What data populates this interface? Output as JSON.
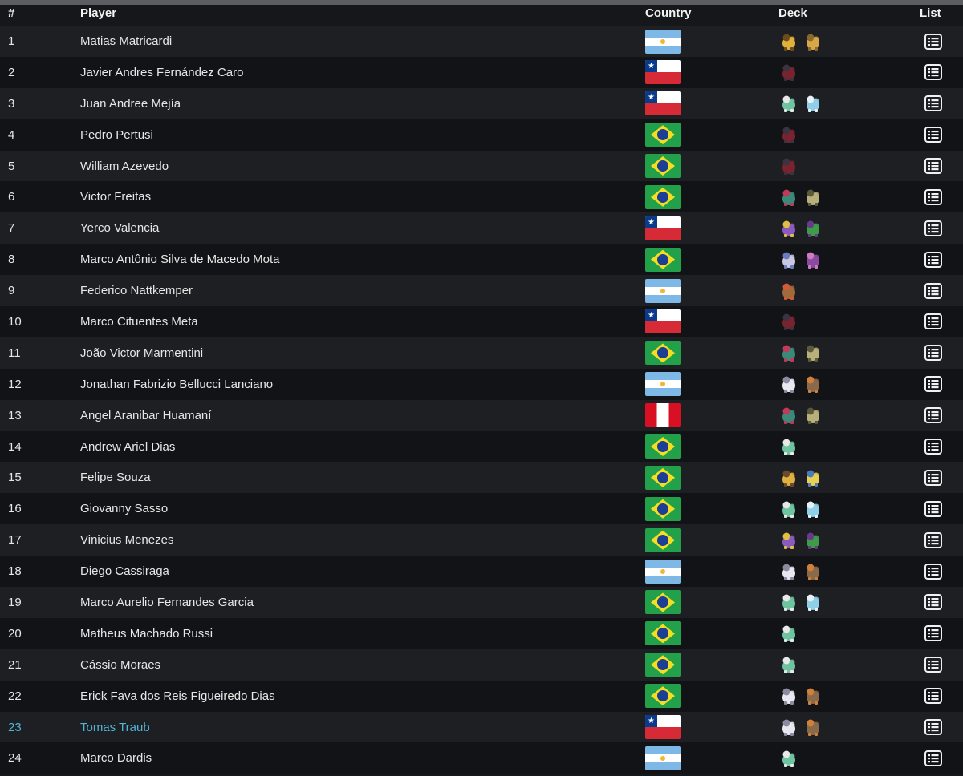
{
  "header": {
    "rank": "#",
    "player": "Player",
    "country": "Country",
    "deck": "Deck",
    "list": "List"
  },
  "rows": [
    {
      "rank": "1",
      "player": "Matias Matricardi",
      "country": "flag-ar",
      "deck": [
        "pokemon-a",
        "pokemon-b"
      ]
    },
    {
      "rank": "2",
      "player": "Javier Andres Fernández Caro",
      "country": "flag-cl",
      "deck": [
        "pokemon-c"
      ]
    },
    {
      "rank": "3",
      "player": "Juan Andree Mejía",
      "country": "flag-cl",
      "deck": [
        "pokemon-d",
        "pokemon-e"
      ]
    },
    {
      "rank": "4",
      "player": "Pedro Pertusi",
      "country": "flag-br",
      "deck": [
        "pokemon-c"
      ]
    },
    {
      "rank": "5",
      "player": "William Azevedo",
      "country": "flag-br",
      "deck": [
        "pokemon-c"
      ]
    },
    {
      "rank": "6",
      "player": "Victor Freitas",
      "country": "flag-br",
      "deck": [
        "pokemon-f",
        "pokemon-g"
      ]
    },
    {
      "rank": "7",
      "player": "Yerco Valencia",
      "country": "flag-cl",
      "deck": [
        "pokemon-h",
        "pokemon-i"
      ]
    },
    {
      "rank": "8",
      "player": "Marco Antônio Silva de Macedo Mota",
      "country": "flag-br",
      "deck": [
        "pokemon-j",
        "pokemon-k"
      ]
    },
    {
      "rank": "9",
      "player": "Federico Nattkemper",
      "country": "flag-ar",
      "deck": [
        "pokemon-l"
      ]
    },
    {
      "rank": "10",
      "player": "Marco Cifuentes Meta",
      "country": "flag-cl",
      "deck": [
        "pokemon-c"
      ]
    },
    {
      "rank": "11",
      "player": "João Victor Marmentini",
      "country": "flag-br",
      "deck": [
        "pokemon-f",
        "pokemon-g"
      ]
    },
    {
      "rank": "12",
      "player": "Jonathan Fabrizio Bellucci Lanciano",
      "country": "flag-ar",
      "deck": [
        "pokemon-m",
        "pokemon-n"
      ]
    },
    {
      "rank": "13",
      "player": "Angel Aranibar Huamaní",
      "country": "flag-pe",
      "deck": [
        "pokemon-f",
        "pokemon-g"
      ]
    },
    {
      "rank": "14",
      "player": "Andrew Ariel Dias",
      "country": "flag-br",
      "deck": [
        "pokemon-d"
      ]
    },
    {
      "rank": "15",
      "player": "Felipe Souza",
      "country": "flag-br",
      "deck": [
        "pokemon-o",
        "pokemon-p"
      ]
    },
    {
      "rank": "16",
      "player": "Giovanny Sasso",
      "country": "flag-br",
      "deck": [
        "pokemon-d",
        "pokemon-e"
      ]
    },
    {
      "rank": "17",
      "player": "Vinicius Menezes",
      "country": "flag-br",
      "deck": [
        "pokemon-h",
        "pokemon-i"
      ]
    },
    {
      "rank": "18",
      "player": "Diego Cassiraga",
      "country": "flag-ar",
      "deck": [
        "pokemon-m",
        "pokemon-n"
      ]
    },
    {
      "rank": "19",
      "player": "Marco Aurelio Fernandes Garcia",
      "country": "flag-br",
      "deck": [
        "pokemon-d",
        "pokemon-e"
      ]
    },
    {
      "rank": "20",
      "player": "Matheus Machado Russi",
      "country": "flag-br",
      "deck": [
        "pokemon-d"
      ]
    },
    {
      "rank": "21",
      "player": "Cássio Moraes",
      "country": "flag-br",
      "deck": [
        "pokemon-d"
      ]
    },
    {
      "rank": "22",
      "player": "Erick Fava dos Reis Figueiredo Dias",
      "country": "flag-br",
      "deck": [
        "pokemon-m",
        "pokemon-n"
      ]
    },
    {
      "rank": "23",
      "player": "Tomas Traub",
      "country": "flag-cl",
      "deck": [
        "pokemon-m",
        "pokemon-n"
      ],
      "highlight": true
    },
    {
      "rank": "24",
      "player": "Marco Dardis",
      "country": "flag-ar",
      "deck": [
        "pokemon-d"
      ]
    }
  ],
  "sprite_colors": {
    "pokemon-a": [
      "#e0b13a",
      "#6b4a1d"
    ],
    "pokemon-b": [
      "#d7a74a",
      "#8a6a2a"
    ],
    "pokemon-c": [
      "#7a2330",
      "#3b3340"
    ],
    "pokemon-d": [
      "#6ec4a0",
      "#e8e8e8"
    ],
    "pokemon-e": [
      "#8fd0e8",
      "#e6f2f8"
    ],
    "pokemon-f": [
      "#3a8a7a",
      "#c23a5a"
    ],
    "pokemon-g": [
      "#b8b07a",
      "#5a5a3a"
    ],
    "pokemon-h": [
      "#8a5ac0",
      "#e0c040"
    ],
    "pokemon-i": [
      "#3f9a4a",
      "#6a3a8a"
    ],
    "pokemon-j": [
      "#c8c8e0",
      "#6a7ac0"
    ],
    "pokemon-k": [
      "#8a4aa0",
      "#d07ac0"
    ],
    "pokemon-l": [
      "#a06a3a",
      "#d05a3a"
    ],
    "pokemon-m": [
      "#e8e8f0",
      "#8a8aa0"
    ],
    "pokemon-n": [
      "#8a6a4a",
      "#d0803a"
    ],
    "pokemon-o": [
      "#e0b040",
      "#6a4a2a"
    ],
    "pokemon-p": [
      "#e8d050",
      "#4a7ac0"
    ]
  },
  "list_icon_name": "list-icon"
}
